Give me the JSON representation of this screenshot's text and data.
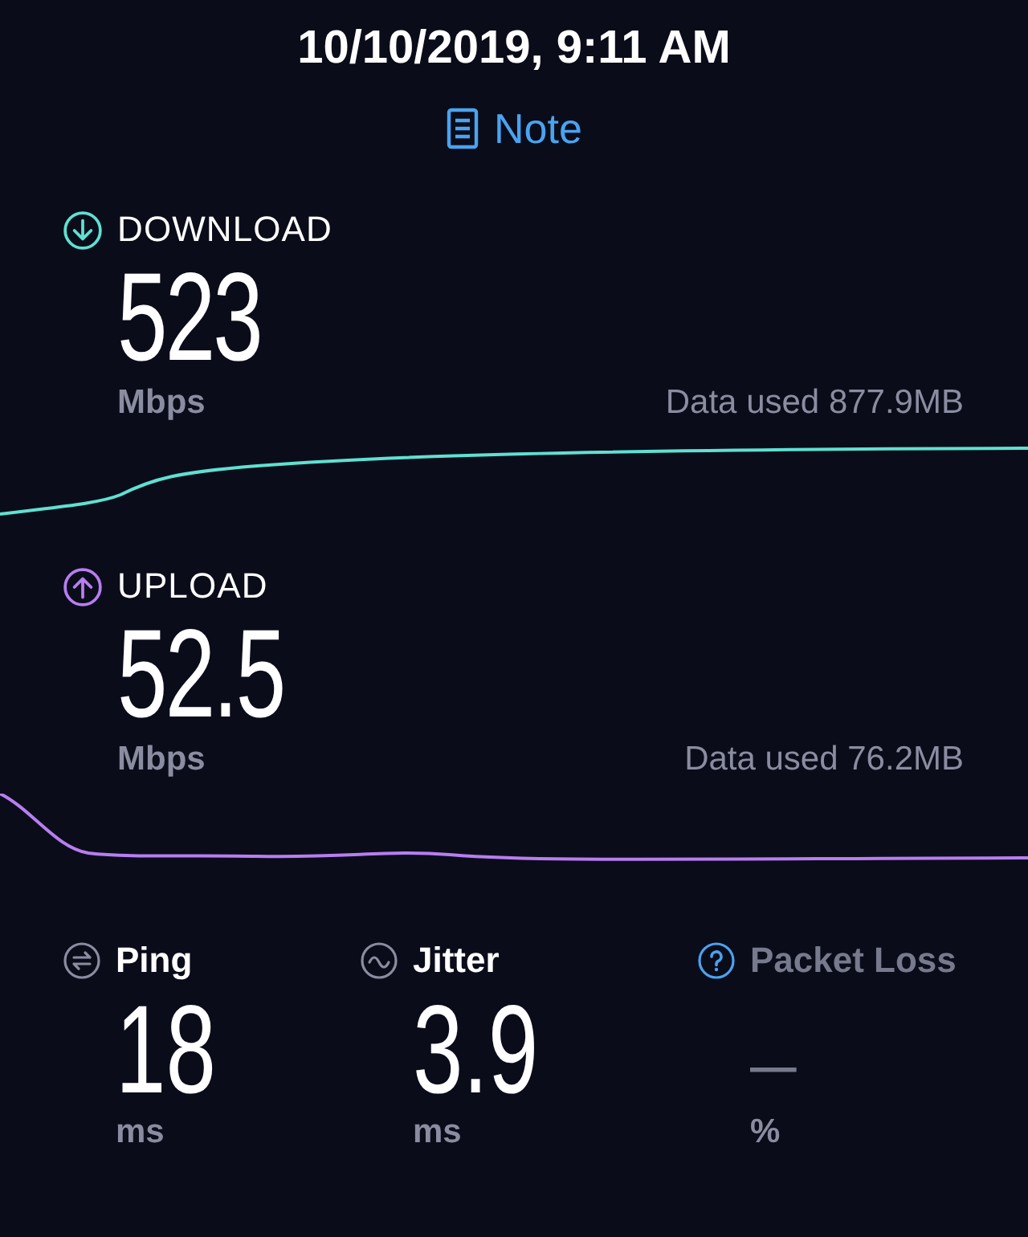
{
  "header": {
    "title": "10/10/2019, 9:11 AM",
    "note_link": "Note"
  },
  "speeds": [
    {
      "kind": "download",
      "label": "DOWNLOAD",
      "value": "523",
      "unit": "Mbps",
      "data_used": "Data used 877.9MB",
      "color": "#5fe0d2"
    },
    {
      "kind": "upload",
      "label": "UPLOAD",
      "value": "52.5",
      "unit": "Mbps",
      "data_used": "Data used 76.2MB",
      "color": "#b77ef0"
    }
  ],
  "metrics": [
    {
      "kind": "ping",
      "label": "Ping",
      "value": "18",
      "unit": "ms",
      "disabled": false
    },
    {
      "kind": "jitter",
      "label": "Jitter",
      "value": "3.9",
      "unit": "ms",
      "disabled": false
    },
    {
      "kind": "packet_loss",
      "label": "Packet Loss",
      "value": "—",
      "unit": "%",
      "disabled": true
    }
  ]
}
